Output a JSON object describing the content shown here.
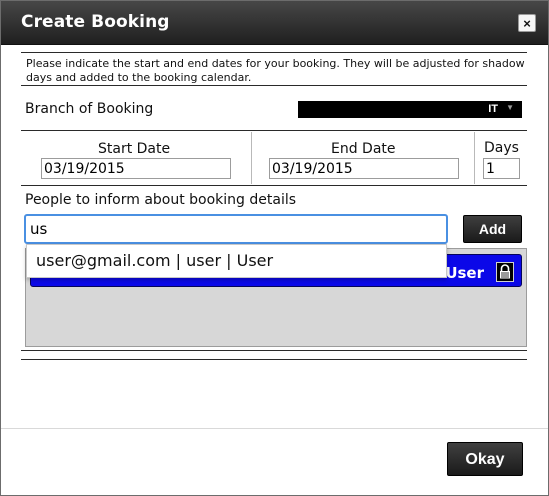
{
  "dialog": {
    "title": "Create Booking",
    "close_label": "×"
  },
  "intro": "Please indicate the start and end dates for your booking. They will be adjusted for shadow days and added to the booking calendar.",
  "branch": {
    "label": "Branch of Booking",
    "selected": "IT",
    "arrow": "▼"
  },
  "dates": {
    "start_label": "Start Date",
    "start_value": "03/19/2015",
    "end_label": "End Date",
    "end_value": "03/19/2015",
    "days_label": "Days",
    "days_value": "1"
  },
  "people": {
    "label": "People to inform about booking details",
    "input_value": "us",
    "add_label": "Add",
    "suggestion": "user@gmail.com | user | User",
    "chip_text": "User"
  },
  "footer": {
    "okay_label": "Okay"
  },
  "icons": {
    "lock": "lock-icon"
  }
}
